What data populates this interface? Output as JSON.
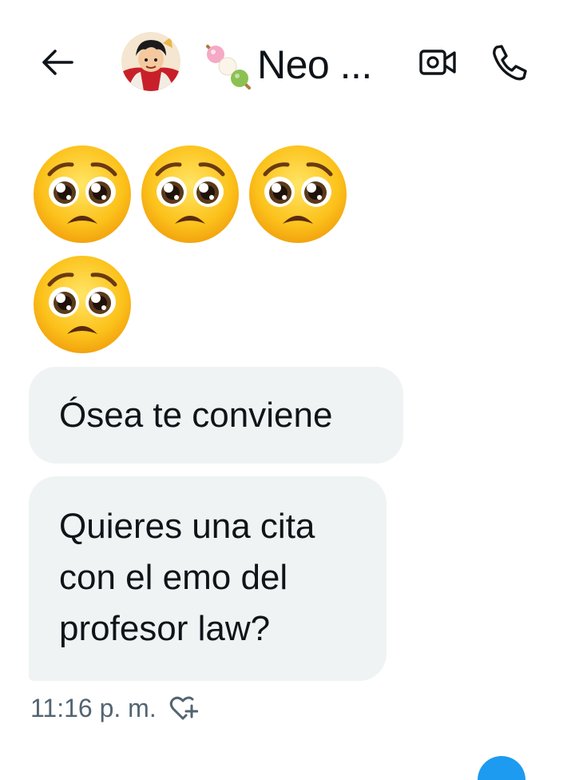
{
  "header": {
    "title": "Neo ...",
    "back_icon": "arrow-left-icon",
    "avatar": "contact-avatar",
    "title_emoji": "dango-emoji",
    "video_icon": "video-camera-icon",
    "call_icon": "phone-icon"
  },
  "messages": {
    "emoji_message": {
      "emoji": "pleading-face-emoji",
      "count": 4
    },
    "bubble_1": {
      "text": "Ósea te conviene"
    },
    "bubble_2": {
      "lines": [
        "Quieres una cita",
        "con el emo del",
        "profesor law?"
      ]
    },
    "timestamp": "11:16 p. m.",
    "react_icon": "heart-plus-icon"
  },
  "colors": {
    "bubble_bg": "#eff3f4",
    "text": "#0f1419",
    "meta_text": "#536471",
    "accent": "#1d9bf0"
  }
}
